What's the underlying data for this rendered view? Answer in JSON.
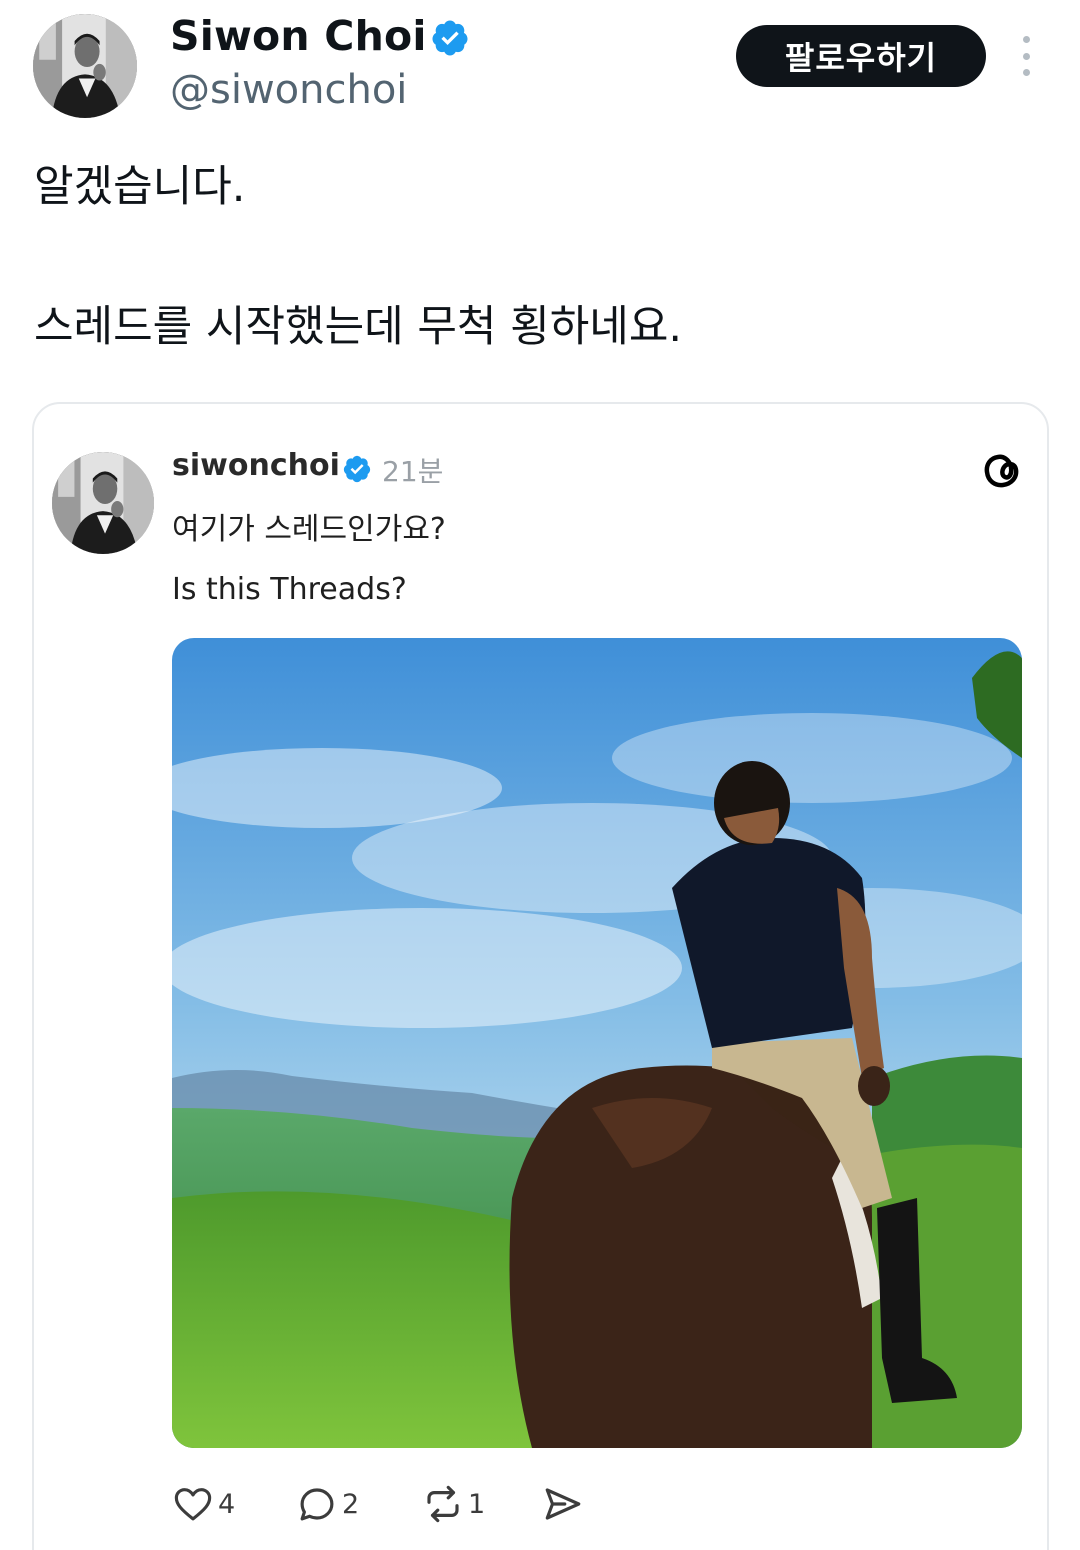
{
  "tweet": {
    "author": {
      "display_name": "Siwon Choi",
      "handle": "@siwonchoi",
      "verified": true
    },
    "follow_label": "팔로우하기",
    "text_lines": [
      "알겠습니다.",
      "스레드를 시작했는데 무척 횡하네요."
    ]
  },
  "embed": {
    "platform_icon": "threads-icon",
    "username": "siwonchoi",
    "verified": true,
    "time": "21분",
    "text_lines": [
      "여기가 스레드인가요?",
      "Is this Threads?"
    ],
    "photo_subject": "person-riding-horse-on-hill",
    "actions": {
      "likes": "4",
      "replies": "2",
      "reposts": "1"
    }
  },
  "colors": {
    "text": "#0f1419",
    "secondary": "#536471",
    "follow_bg": "#0f1419",
    "verified": "#1d9bf0"
  }
}
